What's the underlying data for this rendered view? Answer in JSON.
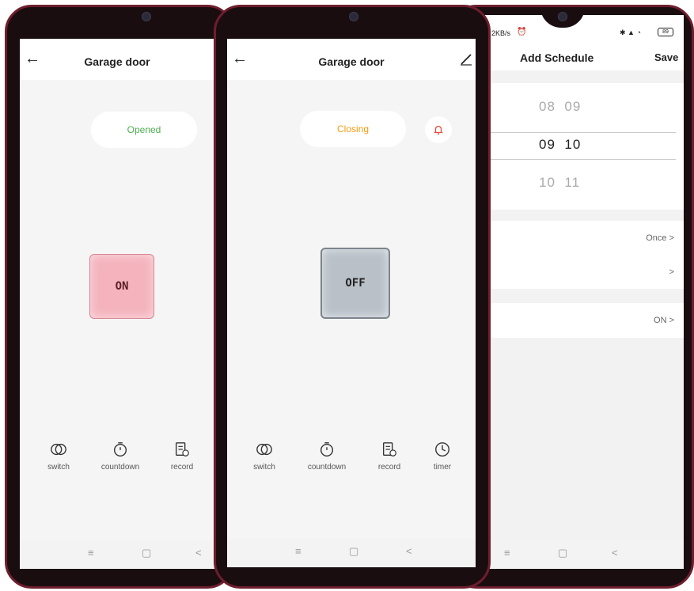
{
  "screen_left": {
    "title": "Garage door",
    "status": "Opened",
    "switch_label": "ON",
    "tools": [
      {
        "label": "switch",
        "icon": "switch-icon"
      },
      {
        "label": "countdown",
        "icon": "countdown-icon"
      },
      {
        "label": "record",
        "icon": "record-icon"
      }
    ],
    "nav": {
      "menu": "≡",
      "home": "▢",
      "back": "<"
    }
  },
  "screen_middle": {
    "title": "Garage door",
    "status": "Closing",
    "switch_label": "OFF",
    "tools": [
      {
        "label": "switch",
        "icon": "switch-icon"
      },
      {
        "label": "countdown",
        "icon": "countdown-icon"
      },
      {
        "label": "record",
        "icon": "record-icon"
      },
      {
        "label": "timer",
        "icon": "timer-icon"
      }
    ],
    "nav": {
      "menu": "≡",
      "home": "▢",
      "back": "<"
    }
  },
  "screen_right": {
    "status_speed": "2KB/s",
    "battery": "89",
    "title": "Add Schedule",
    "save_label": "Save",
    "time_picker": {
      "above": {
        "hour": "08",
        "minute": "09"
      },
      "selected": {
        "hour": "09",
        "minute": "10"
      },
      "below": {
        "hour": "10",
        "minute": "11"
      }
    },
    "rows": [
      {
        "value": "Once >"
      },
      {
        "value": ">"
      },
      {
        "value": "ON >"
      }
    ],
    "nav": {
      "menu": "≡",
      "home": "▢",
      "back": "<"
    }
  },
  "colors": {
    "opened": "#4caf50",
    "closing": "#f39c12",
    "on_button": "#f2a8b3",
    "off_button": "#b9c0c8",
    "frame": "#6e1e2e",
    "bell": "#e74c3c"
  }
}
